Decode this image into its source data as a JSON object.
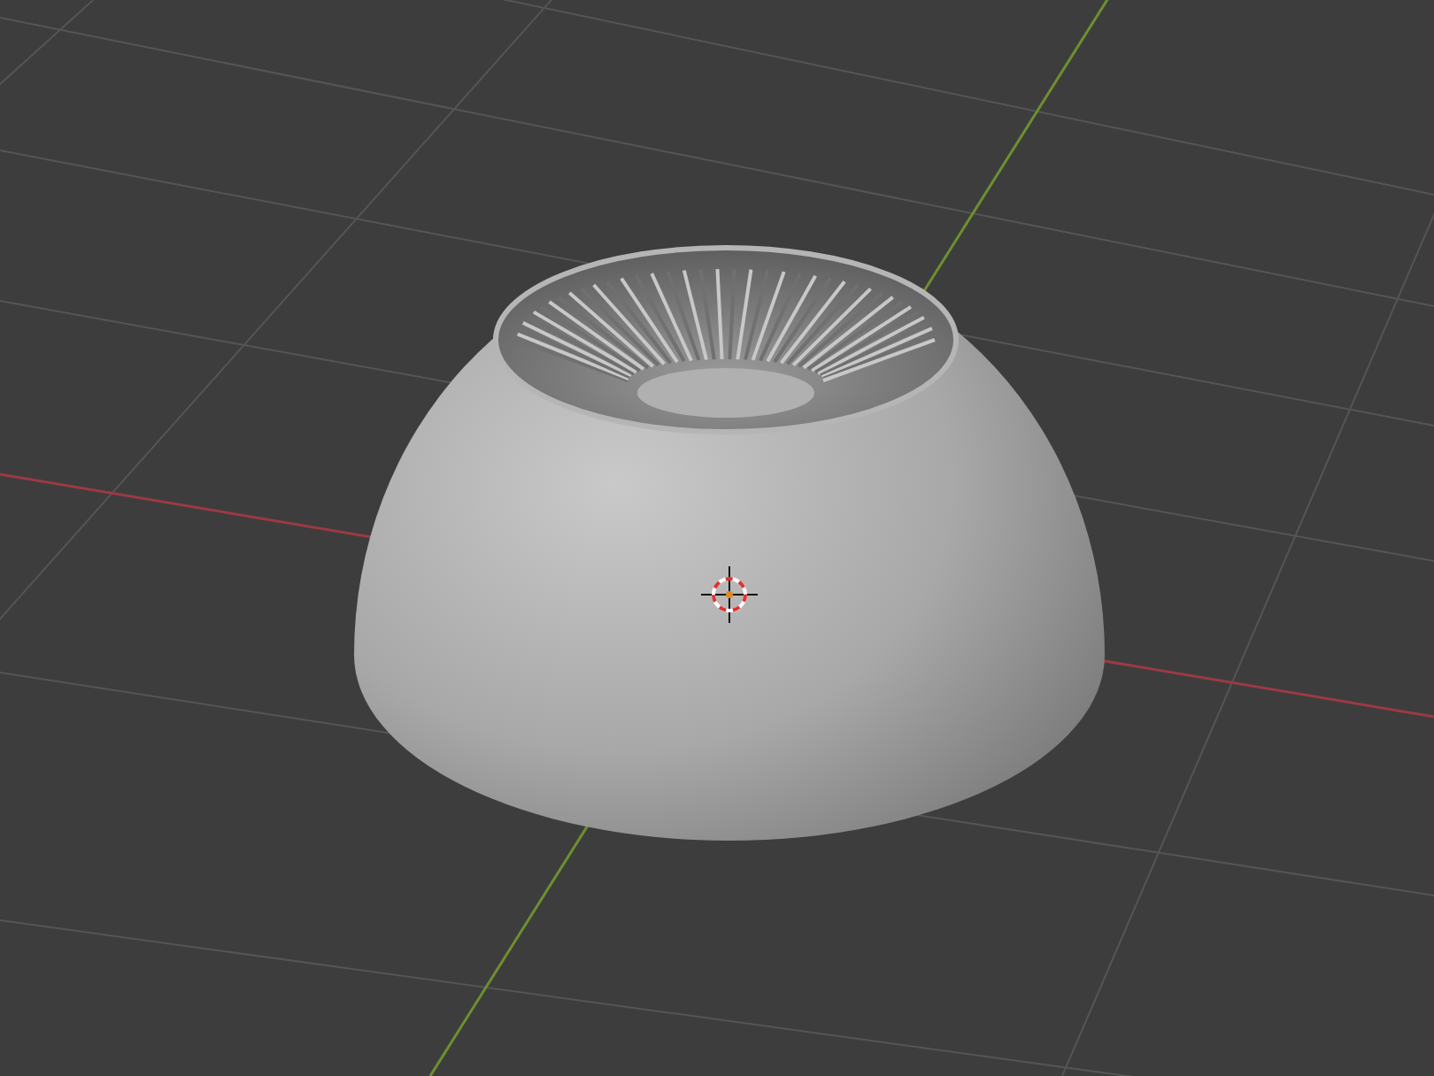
{
  "viewport": {
    "axes": [
      {
        "kind": "x",
        "color": "#9b3a44"
      },
      {
        "kind": "y",
        "color": "#6e8f2e"
      }
    ]
  }
}
